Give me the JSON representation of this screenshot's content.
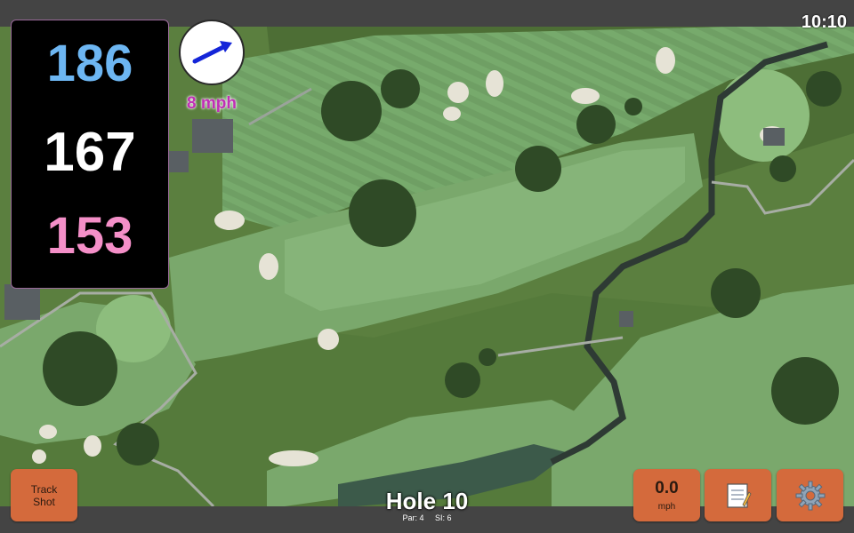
{
  "status": {
    "time": "10:10"
  },
  "yardages": {
    "back": "186",
    "middle": "167",
    "front": "153"
  },
  "wind": {
    "speed": "8 mph",
    "arrow_icon": "wind-arrow-icon"
  },
  "hole": {
    "title": "Hole 10",
    "par": "Par: 4",
    "si": "SI: 6"
  },
  "buttons": {
    "track_line1": "Track",
    "track_line2": "Shot",
    "shot_speed_value": "0.0",
    "shot_speed_unit": "mph",
    "notes_icon": "notepad-icon",
    "settings_icon": "gear-icon"
  },
  "colors": {
    "back": "#6db6f2",
    "middle": "#ffffff",
    "front": "#f48fc8",
    "wind": "#c02fb5",
    "button": "#d46a3c"
  }
}
